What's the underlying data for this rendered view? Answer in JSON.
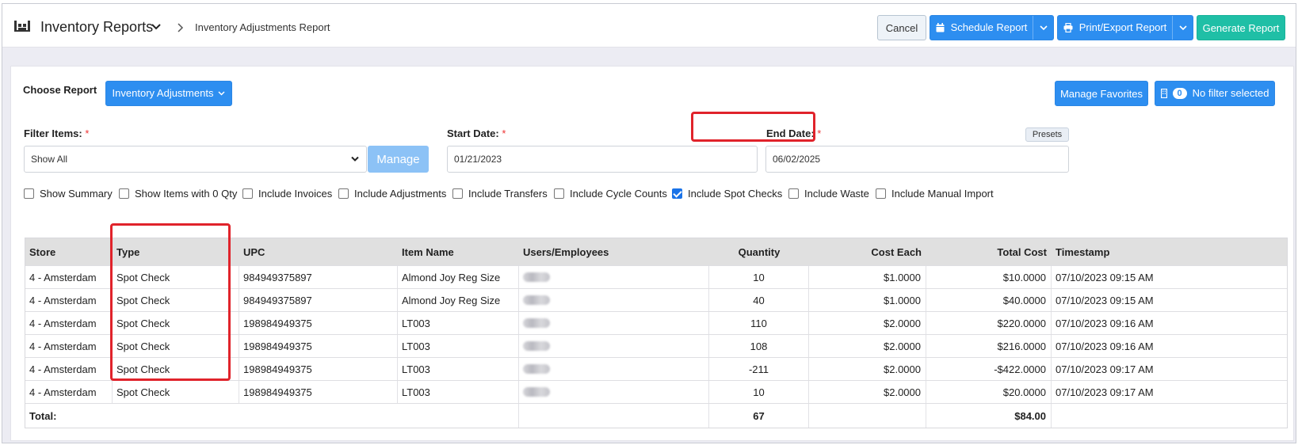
{
  "header": {
    "app_title": "Inventory Reports",
    "breadcrumb": "Inventory Adjustments Report",
    "buttons": {
      "cancel": "Cancel",
      "schedule": "Schedule Report",
      "print": "Print/Export Report",
      "generate": "Generate Report"
    }
  },
  "controls": {
    "choose_report_label": "Choose Report",
    "report_selected": "Inventory Adjustments",
    "manage_favorites": "Manage Favorites",
    "filter_count": "0",
    "filter_status": "No filter selected",
    "filter_items_label": "Filter Items:",
    "filter_items_value": "Show All",
    "manage_button": "Manage",
    "start_date_label": "Start Date:",
    "start_date_value": "01/21/2023",
    "end_date_label": "End Date:",
    "end_date_value": "06/02/2025",
    "presets": "Presets",
    "required_mark": "*"
  },
  "options": [
    {
      "label": "Show Summary",
      "checked": false
    },
    {
      "label": "Show Items with 0 Qty",
      "checked": false
    },
    {
      "label": "Include Invoices",
      "checked": false
    },
    {
      "label": "Include Adjustments",
      "checked": false
    },
    {
      "label": "Include Transfers",
      "checked": false
    },
    {
      "label": "Include Cycle Counts",
      "checked": false
    },
    {
      "label": "Include Spot Checks",
      "checked": true
    },
    {
      "label": "Include Waste",
      "checked": false
    },
    {
      "label": "Include Manual Import",
      "checked": false
    }
  ],
  "table": {
    "columns": [
      "Store",
      "Type",
      "UPC",
      "Item Name",
      "Users/Employees",
      "Quantity",
      "Cost Each",
      "Total Cost",
      "Timestamp"
    ],
    "rows": [
      {
        "store": "4 - Amsterdam",
        "type": "Spot Check",
        "upc": "984949375897",
        "item": "Almond Joy Reg Size",
        "qty": "10",
        "cost": "$1.0000",
        "total": "$10.0000",
        "ts": "07/10/2023 09:15 AM"
      },
      {
        "store": "4 - Amsterdam",
        "type": "Spot Check",
        "upc": "984949375897",
        "item": "Almond Joy Reg Size",
        "qty": "40",
        "cost": "$1.0000",
        "total": "$40.0000",
        "ts": "07/10/2023 09:15 AM"
      },
      {
        "store": "4 - Amsterdam",
        "type": "Spot Check",
        "upc": "198984949375",
        "item": "LT003",
        "qty": "110",
        "cost": "$2.0000",
        "total": "$220.0000",
        "ts": "07/10/2023 09:16 AM"
      },
      {
        "store": "4 - Amsterdam",
        "type": "Spot Check",
        "upc": "198984949375",
        "item": "LT003",
        "qty": "108",
        "cost": "$2.0000",
        "total": "$216.0000",
        "ts": "07/10/2023 09:16 AM"
      },
      {
        "store": "4 - Amsterdam",
        "type": "Spot Check",
        "upc": "198984949375",
        "item": "LT003",
        "qty": "-211",
        "cost": "$2.0000",
        "total": "-$422.0000",
        "ts": "07/10/2023 09:17 AM"
      },
      {
        "store": "4 - Amsterdam",
        "type": "Spot Check",
        "upc": "198984949375",
        "item": "LT003",
        "qty": "10",
        "cost": "$2.0000",
        "total": "$20.0000",
        "ts": "07/10/2023 09:17 AM"
      }
    ],
    "total": {
      "label": "Total:",
      "qty": "67",
      "total": "$84.00"
    }
  }
}
